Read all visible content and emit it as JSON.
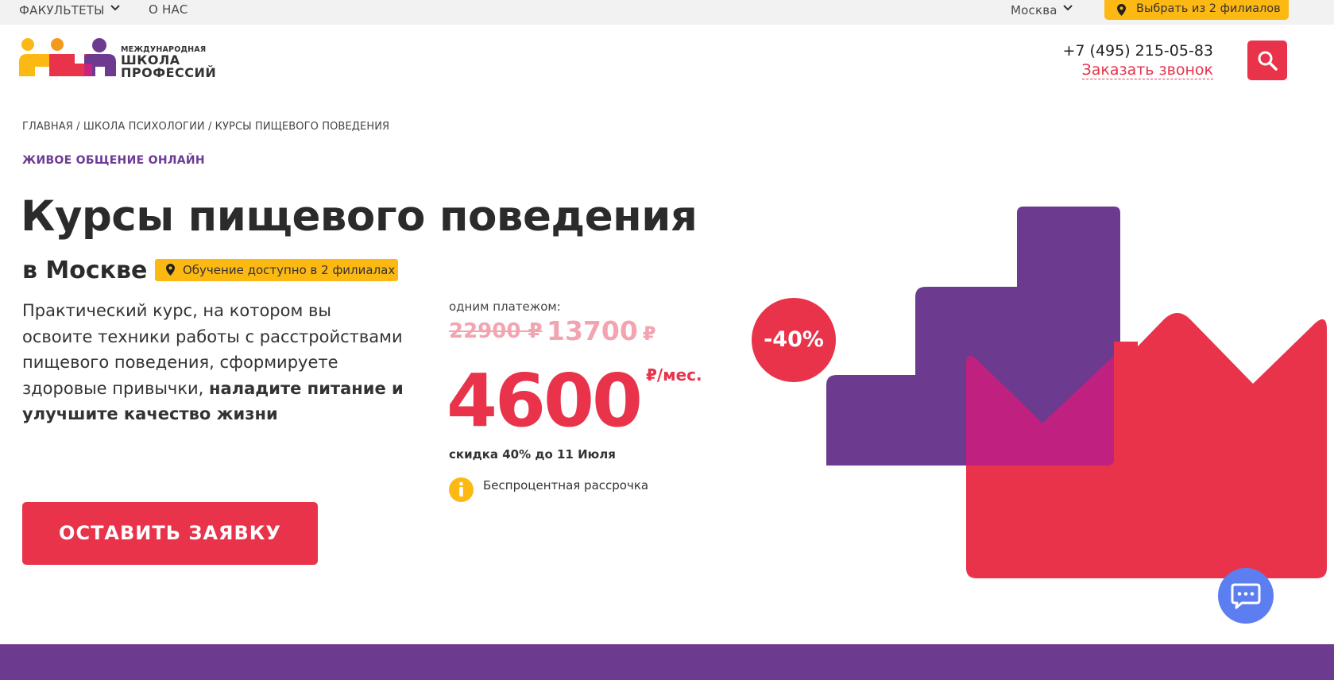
{
  "topbar": {
    "faculties": "ФАКУЛЬТЕТЫ",
    "about": "О НАС",
    "city": "Москва",
    "branches": "Выбрать из 2 филиалов"
  },
  "header": {
    "logo_small": "МЕЖДУНАРОДНАЯ",
    "logo_line1": "ШКОЛА",
    "logo_line2": "ПРОФЕССИЙ",
    "phone": "+7 (495) 215-05-83",
    "callback": "Заказать звонок"
  },
  "breadcrumb": "ГЛАВНАЯ / ШКОЛА ПСИХОЛОГИИ / КУРСЫ ПИЩЕВОГО ПОВЕДЕНИЯ",
  "eyebrow": "ЖИВОЕ ОБЩЕНИЕ ОНЛАЙН",
  "title": "Курсы пищевого поведения",
  "subtitle": "в Москве",
  "availability": "Обучение доступно в 2 филиалах",
  "description": {
    "plain": "Практический курс, на котором вы освоите техники работы с расстройствами пищевого поведения, сформируете здоровые привычки,",
    "bold": "наладите питание и улучшите качество жизни"
  },
  "cta": "ОСТАВИТЬ ЗАЯВКУ",
  "pricing": {
    "one_payment_label": "одним платежом:",
    "old_price": "22900 ₽",
    "mid_price": "13700",
    "mid_currency": "₽",
    "monthly_price": "4600",
    "per_month": "₽/мес.",
    "discount_note": "скидка 40% до 11 Июля",
    "installment": "Беспроцентная рассрочка"
  },
  "discount_badge": "-40%",
  "colors": {
    "brand_red": "#e8334a",
    "brand_purple": "#6c3a8e",
    "brand_yellow": "#fdb913",
    "chat_blue": "#5c7ef0"
  },
  "icons": [
    "chevron-down-icon",
    "pin-icon",
    "search-icon",
    "info-icon",
    "chat-icon"
  ]
}
